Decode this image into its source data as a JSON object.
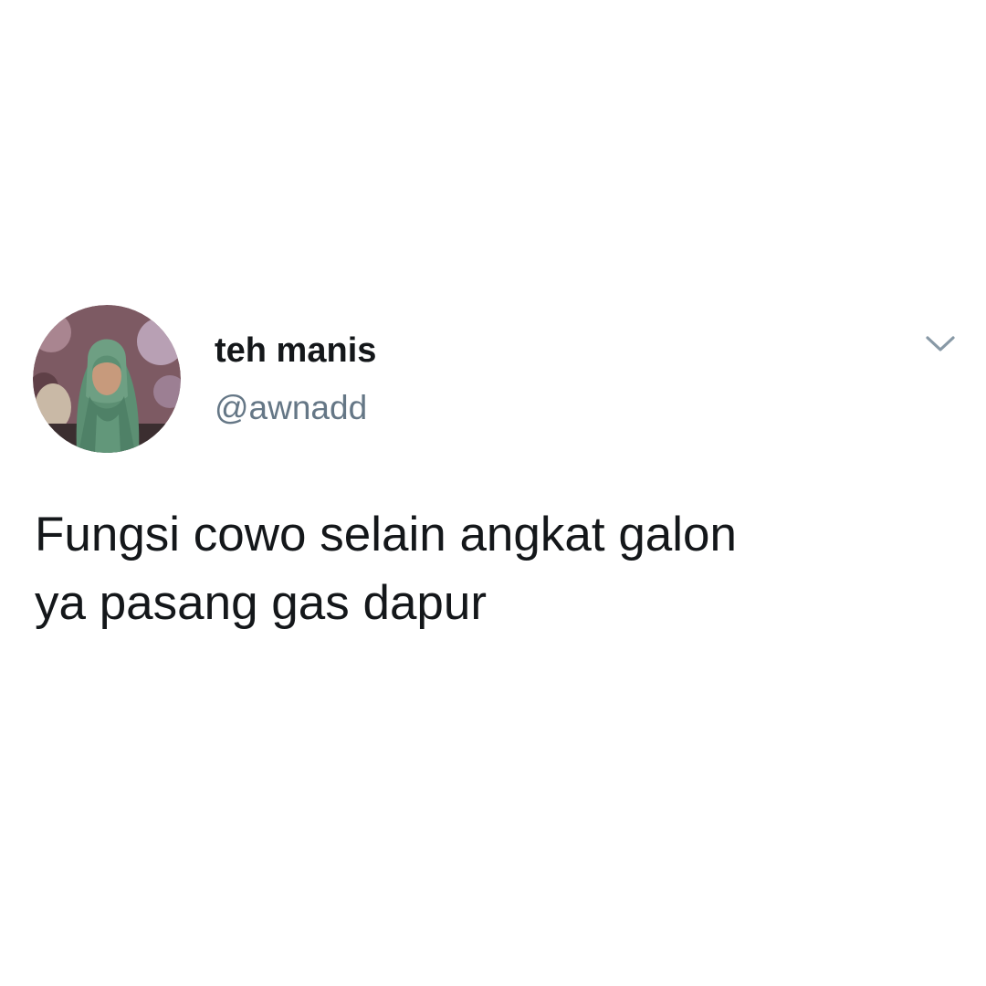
{
  "tweet": {
    "author": {
      "display_name": "teh manis",
      "handle": "@awnadd",
      "avatar_icon": "profile-photo-green-hijab"
    },
    "menu_icon": "chevron-down-icon",
    "text_lines": [
      "Fungsi cowo selain angkat galon",
      "ya pasang gas dapur"
    ]
  },
  "colors": {
    "background": "#ffffff",
    "text_primary": "#14171a",
    "text_secondary": "#657786",
    "chevron": "#8899a6"
  }
}
